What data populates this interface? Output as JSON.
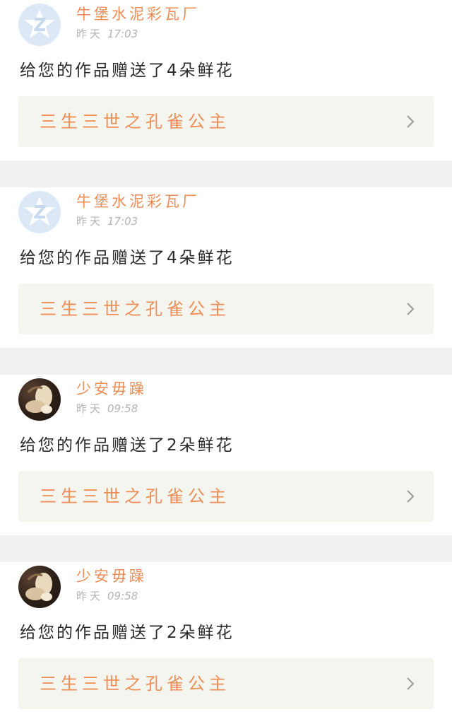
{
  "notifications": [
    {
      "username": "牛堡水泥彩瓦厂",
      "day": "昨天",
      "time": "17:03",
      "message": "给您的作品赠送了4朵鲜花",
      "work_title": "三生三世之孔雀公主",
      "avatar": "default-qq-avatar-icon"
    },
    {
      "username": "牛堡水泥彩瓦厂",
      "day": "昨天",
      "time": "17:03",
      "message": "给您的作品赠送了4朵鲜花",
      "work_title": "三生三世之孔雀公主",
      "avatar": "default-qq-avatar-icon"
    },
    {
      "username": "少安毋躁",
      "day": "昨天",
      "time": "09:58",
      "message": "给您的作品赠送了2朵鲜花",
      "work_title": "三生三世之孔雀公主",
      "avatar": "user-photo-avatar"
    },
    {
      "username": "少安毋躁",
      "day": "昨天",
      "time": "09:58",
      "message": "给您的作品赠送了2朵鲜花",
      "work_title": "三生三世之孔雀公主",
      "avatar": "user-photo-avatar"
    }
  ],
  "colors": {
    "accent": "#ee8d55",
    "timestamp": "#b3b3b3",
    "link_background": "#f5f5ef",
    "separator": "#f1f1f1",
    "default_avatar": "#dce8f6"
  },
  "icons": {
    "chevron": "chevron-right-icon"
  }
}
